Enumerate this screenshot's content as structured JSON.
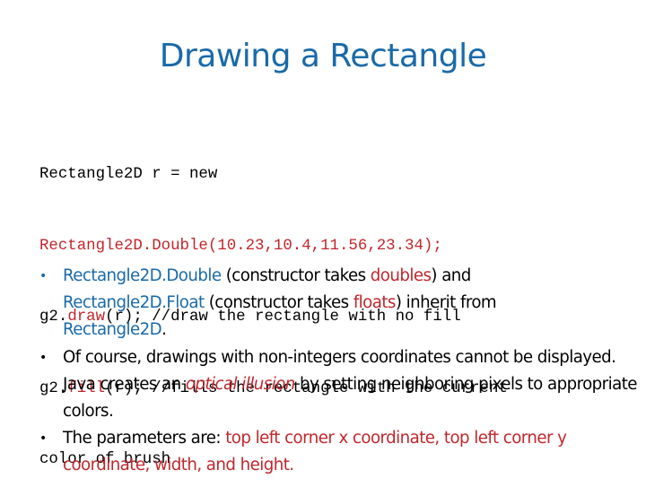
{
  "slide": {
    "title": "Drawing a Rectangle",
    "colors": {
      "title": "#1a6aa8",
      "accent_blue": "#1a6aa8",
      "accent_red": "#c0262b",
      "text": "#000000",
      "background": "#ffffff"
    }
  },
  "code": {
    "line1": "Rectangle2D r = new",
    "line2": "Rectangle2D.Double(10.23,10.4,11.56,23.34);",
    "line3": {
      "prefix": "g2.",
      "method": "draw",
      "suffix": "(r); //draw the rectangle with no fill"
    },
    "line4": {
      "prefix": "g2.",
      "method": "fill",
      "suffix": "(r); //fills the rectangle with the current"
    },
    "line5": "color of brush"
  },
  "bullets": [
    {
      "icon": "bullet-dot",
      "dot_color": "#1a6aa8",
      "parts": [
        "Rectangle2D.Double",
        " (constructor takes ",
        "doubles",
        ") and",
        "Rectangle2D.Float",
        " (constructor takes ",
        "floats",
        ") inherit from",
        "Rectangle2D",
        "."
      ]
    },
    {
      "icon": "bullet-dot",
      "dot_color": "#000000",
      "parts": [
        "Of course, drawings with non-integers coordinates cannot be displayed. Java creates an ",
        "optical illusion",
        " by setting neighboring pixels to appropriate colors."
      ]
    },
    {
      "icon": "bullet-dot",
      "dot_color": "#000000",
      "parts": [
        "The parameters are: ",
        "top left corner x coordinate, top left corner y coordinate, width, and height."
      ]
    }
  ],
  "bullet_glyph": "•"
}
